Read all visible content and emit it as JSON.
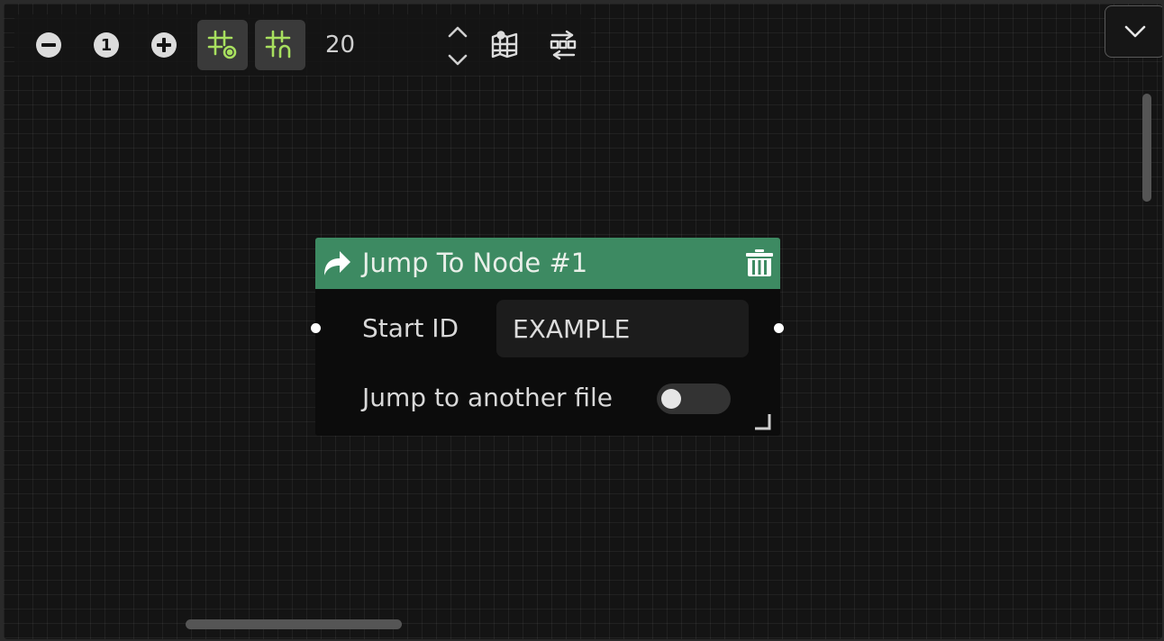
{
  "colors": {
    "canvas_bg": "#141414",
    "accent_green": "#a8e05f",
    "node_header": "#3d8a62"
  },
  "toolbar": {
    "zoom_out_icon": "minus-circle-icon",
    "zoom_reset_label": "1",
    "zoom_in_icon": "plus-circle-icon",
    "grid_size_value": "20",
    "snap_to_grid_active": true,
    "show_grid_active": true
  },
  "node": {
    "title": "Jump To Node #1",
    "start_id_label": "Start ID",
    "start_id_value": "EXAMPLE",
    "jump_file_label": "Jump to another file",
    "jump_file_enabled": false
  }
}
